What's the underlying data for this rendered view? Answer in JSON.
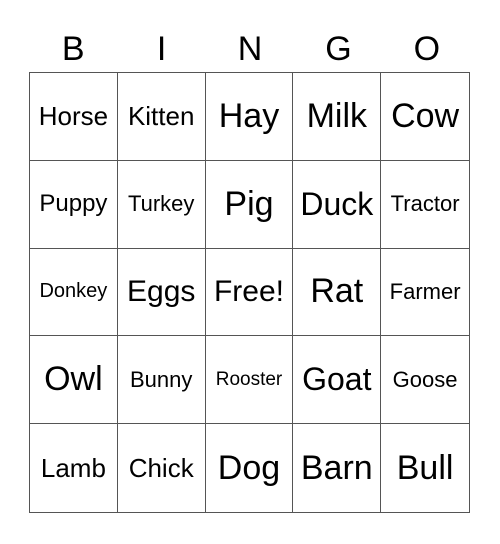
{
  "header": [
    "B",
    "I",
    "N",
    "G",
    "O"
  ],
  "cells": [
    {
      "text": "Horse",
      "size": 26
    },
    {
      "text": "Kitten",
      "size": 26
    },
    {
      "text": "Hay",
      "size": 34
    },
    {
      "text": "Milk",
      "size": 34
    },
    {
      "text": "Cow",
      "size": 34
    },
    {
      "text": "Puppy",
      "size": 24
    },
    {
      "text": "Turkey",
      "size": 22
    },
    {
      "text": "Pig",
      "size": 34
    },
    {
      "text": "Duck",
      "size": 32
    },
    {
      "text": "Tractor",
      "size": 22
    },
    {
      "text": "Donkey",
      "size": 20
    },
    {
      "text": "Eggs",
      "size": 30
    },
    {
      "text": "Free!",
      "size": 30
    },
    {
      "text": "Rat",
      "size": 34
    },
    {
      "text": "Farmer",
      "size": 22
    },
    {
      "text": "Owl",
      "size": 34
    },
    {
      "text": "Bunny",
      "size": 22
    },
    {
      "text": "Rooster",
      "size": 19
    },
    {
      "text": "Goat",
      "size": 32
    },
    {
      "text": "Goose",
      "size": 22
    },
    {
      "text": "Lamb",
      "size": 26
    },
    {
      "text": "Chick",
      "size": 26
    },
    {
      "text": "Dog",
      "size": 34
    },
    {
      "text": "Barn",
      "size": 34
    },
    {
      "text": "Bull",
      "size": 34
    }
  ]
}
